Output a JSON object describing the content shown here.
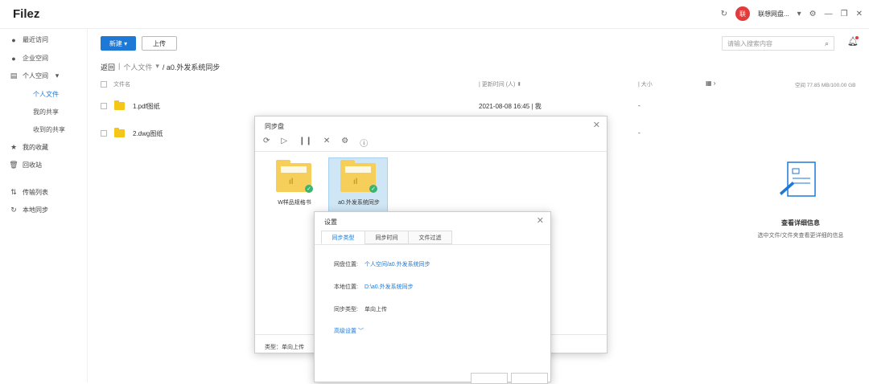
{
  "app": {
    "logo": "Filez"
  },
  "topbar": {
    "workspace_label": "联想网盘...",
    "avatar_text": "联",
    "refresh_icon": "refresh-icon",
    "chevron_icon": "chevron-down-icon"
  },
  "sidebar": {
    "items": [
      {
        "label": "最近访问",
        "icon": "clock-icon"
      },
      {
        "label": "企业空间",
        "icon": "building-icon"
      },
      {
        "label": "个人空间",
        "icon": "folder-icon"
      },
      {
        "label": "我的收藏",
        "icon": "star-icon"
      },
      {
        "label": "回收站",
        "icon": "trash-icon"
      },
      {
        "label": "传输列表",
        "icon": "transfer-icon"
      },
      {
        "label": "本地同步",
        "icon": "sync-icon"
      }
    ],
    "subitems": [
      {
        "label": "个人文件",
        "active": true
      },
      {
        "label": "我的共享",
        "active": false
      },
      {
        "label": "收到的共享",
        "active": false
      }
    ]
  },
  "toolbar": {
    "new_label": "新建",
    "upload_label": "上传",
    "search_placeholder": "请输入搜索内容"
  },
  "breadcrumb": {
    "back": "返回",
    "sep": "|",
    "root": "个人文件",
    "current": "/ a0.外发系统同步"
  },
  "table": {
    "headers": {
      "name": "文件名",
      "updated": "更新时间 (人)",
      "size": "大小",
      "quota": "空间 77.85 MB/100.00 GB"
    },
    "rows": [
      {
        "name": "1.pdf图纸",
        "updated": "2021-08-08 16:45 | 我",
        "size": "-"
      },
      {
        "name": "2.dwg图纸",
        "updated": "",
        "size": "-"
      }
    ]
  },
  "detail": {
    "title": "查看详细信息",
    "subtitle": "选中文件/文件夹查看更详细的信息"
  },
  "sync_dialog": {
    "title": "同步盘",
    "folders": [
      {
        "label": "W样品规格书",
        "selected": false
      },
      {
        "label": "a0.外发系统同步",
        "selected": true
      }
    ],
    "footer": "类型：单向上传"
  },
  "settings_dialog": {
    "title": "设置",
    "tabs": [
      "同步类型",
      "同步时间",
      "文件过滤"
    ],
    "fields": [
      {
        "label": "网盘位置:",
        "value": "个人空间/a0.外发系统同步"
      },
      {
        "label": "本地位置:",
        "value": "D:\\a0.外发系统同步"
      },
      {
        "label": "同步类型:",
        "value": "单向上传"
      }
    ],
    "advanced": "高级设置"
  },
  "colors": {
    "accent": "#1e78d6",
    "folder": "#f5c518",
    "ok": "#3cb371",
    "avatar": "#e23b3b"
  }
}
